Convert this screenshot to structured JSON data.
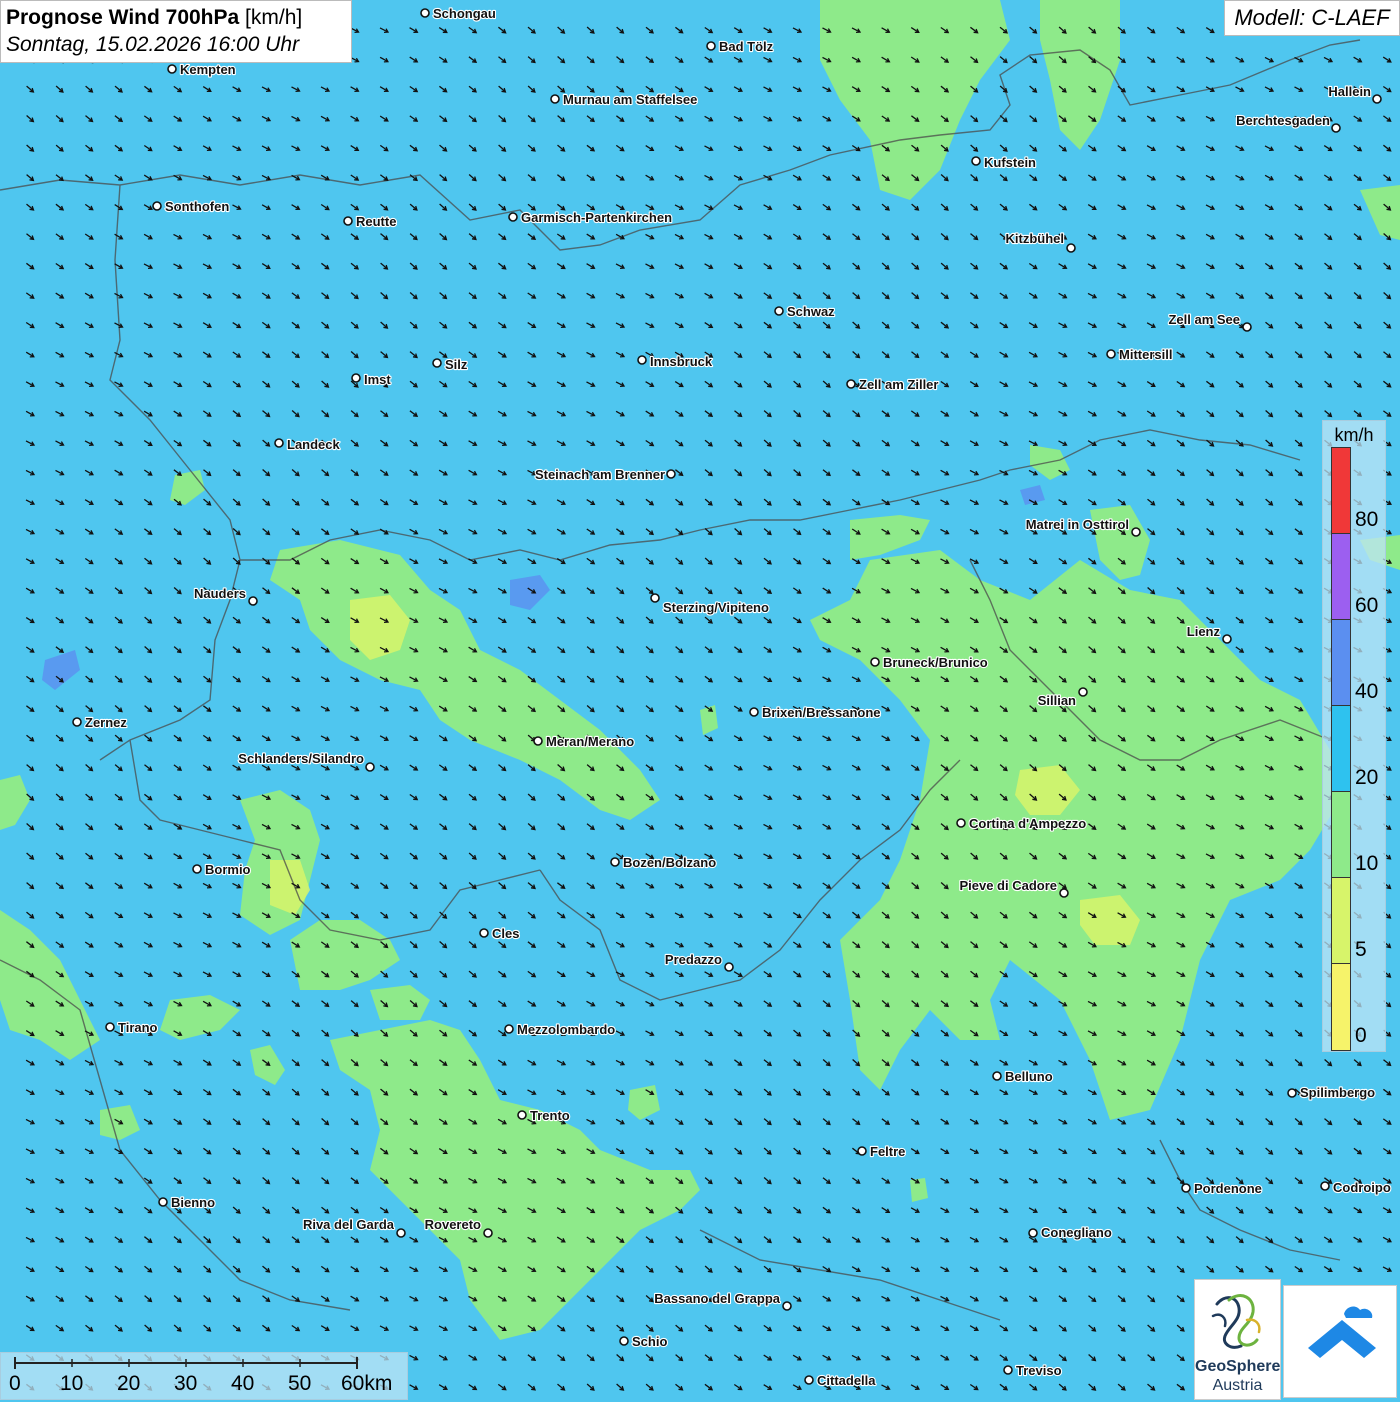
{
  "title": {
    "main": "Prognose Wind 700hPa",
    "unit": "[km/h]",
    "datetime": "Sonntag, 15.02.2026 16:00 Uhr"
  },
  "model": "Modell: C-LAEF",
  "legend": {
    "unit": "km/h",
    "labels": [
      "80",
      "60",
      "40",
      "20",
      "10",
      "5",
      "0"
    ],
    "colors": [
      "#f03838",
      "#9c5ff0",
      "#5b8ff0",
      "#2ec2ef",
      "#8eea8a",
      "#d7f46a",
      "#f6f36a"
    ]
  },
  "scale_bar": {
    "labels": [
      "0",
      "10",
      "20",
      "30",
      "40",
      "50",
      "60km"
    ]
  },
  "wind": {
    "direction": "from northwest (arrows pointing south-east)",
    "dominant_band": "20-40 km/h",
    "weak_band": "10-20 km/h"
  },
  "places": [
    "Schongau",
    "Bad Tölz",
    "Kempten",
    "Murnau am Staffelsee",
    "Hallein",
    "Berchtesgaden",
    "Kufstein",
    "Sonthofen",
    "Reutte",
    "Garmisch-Partenkirchen",
    "Kitzbühel",
    "Schwaz",
    "Zell am See",
    "Innsbruck",
    "Silz",
    "Imst",
    "Mittersill",
    "Zell am Ziller",
    "Landeck",
    "Steinach am Brenner",
    "Matrei in Osttirol",
    "Nauders",
    "Sterzing/Vipiteno",
    "Lienz",
    "Bruneck/Brunico",
    "Sillian",
    "Zernez",
    "Brixen/Bressanone",
    "Meran/Merano",
    "Schlanders/Silandro",
    "Cortina d'Ampezzo",
    "Bozen/Bolzano",
    "Bormio",
    "Pieve di Cadore",
    "Cles",
    "Predazzo",
    "Tirano",
    "Mezzolombardo",
    "Belluno",
    "Spilimbergo",
    "Trento",
    "Feltre",
    "Pordenone",
    "Codroipo",
    "Bienno",
    "Riva del Garda",
    "Rovereto",
    "Conegliano",
    "Bassano del Grappa",
    "Schio",
    "Treviso",
    "Cittadella"
  ],
  "logos": {
    "brand": "GeoSphere",
    "brand_sub": "Austria"
  }
}
